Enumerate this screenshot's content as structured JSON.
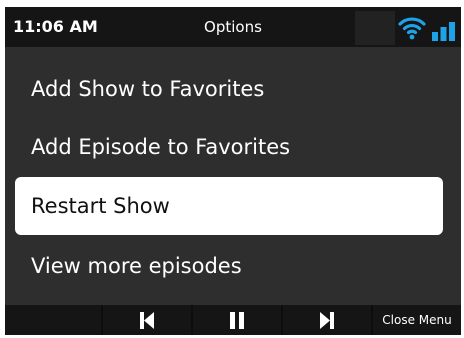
{
  "statusbar": {
    "time": "11:06 AM",
    "title": "Options",
    "icons": [
      "wifi-icon",
      "signal-bars-icon"
    ]
  },
  "menu": {
    "items": [
      {
        "label": "Add Show to Favorites",
        "selected": false
      },
      {
        "label": "Add Episode to Favorites",
        "selected": false
      },
      {
        "label": "Restart Show",
        "selected": true
      },
      {
        "label": "View more episodes",
        "selected": false
      }
    ]
  },
  "controls": {
    "buttons": [
      "previous-icon",
      "pause-icon",
      "next-icon"
    ],
    "close_label": "Close Menu"
  },
  "colors": {
    "background": "#2e2e2e",
    "statusbar": "#151515",
    "accent_blue": "#1fa3e8",
    "selected_bg": "#ffffff"
  }
}
